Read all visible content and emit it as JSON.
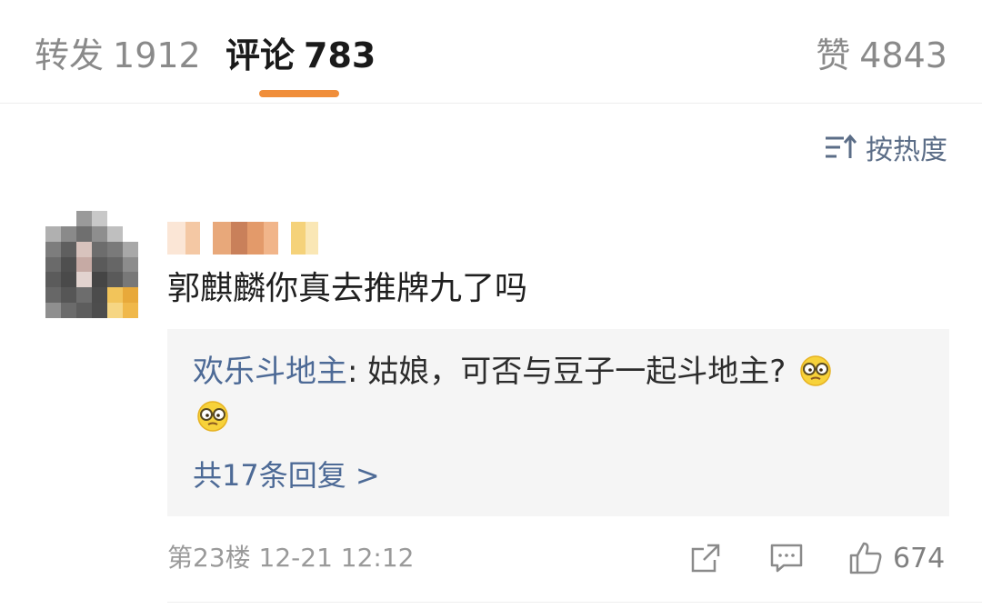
{
  "tabs": {
    "repost": {
      "label": "转发",
      "count": "1912"
    },
    "comment": {
      "label": "评论",
      "count": "783"
    },
    "like": {
      "label": "赞",
      "count": "4843"
    }
  },
  "sort": {
    "label": "按热度",
    "icon": "sort-icon"
  },
  "comment": {
    "text": "郭麒麟你真去推牌九了吗",
    "reply": {
      "author": "欢乐斗地主",
      "text": ": 姑娘，可否与豆子一起斗地主?",
      "emoji": "glasses-emoji-icon",
      "more_label": "共17条回复 >"
    },
    "meta": "第23楼 12-21 12:12",
    "likes": "674"
  },
  "colors": {
    "accent": "#f08e3a",
    "link": "#4d6a96",
    "muted": "#8a8a8a",
    "reply_bg": "#f5f5f5"
  }
}
